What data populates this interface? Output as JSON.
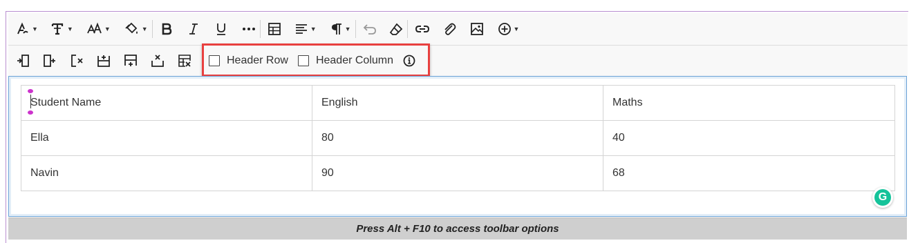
{
  "toolbar": {
    "row1": [
      {
        "name": "text-style-icon",
        "caret": true
      },
      {
        "name": "font-format-icon",
        "caret": true
      },
      {
        "name": "font-size-icon",
        "caret": true
      },
      {
        "name": "fill-color-icon",
        "caret": true
      },
      {
        "name": "bold-icon",
        "caret": false
      },
      {
        "name": "italic-icon",
        "caret": false
      },
      {
        "name": "underline-icon",
        "caret": false
      },
      {
        "name": "more-icon",
        "caret": false
      },
      {
        "name": "table-icon",
        "caret": false
      },
      {
        "name": "align-icon",
        "caret": true
      },
      {
        "name": "paragraph-icon",
        "caret": true
      },
      {
        "name": "undo-icon",
        "caret": false
      },
      {
        "name": "eraser-icon",
        "caret": false
      },
      {
        "name": "link-icon",
        "caret": false
      },
      {
        "name": "attach-icon",
        "caret": false
      },
      {
        "name": "image-icon",
        "caret": false
      },
      {
        "name": "add-content-icon",
        "caret": true
      }
    ],
    "row2": [
      "insert-column-before-icon",
      "insert-column-after-icon",
      "delete-column-icon",
      "insert-row-before-icon",
      "insert-row-after-icon",
      "delete-row-icon",
      "delete-table-icon"
    ],
    "header_row_label": "Header Row",
    "header_column_label": "Header Column",
    "header_row_checked": false,
    "header_column_checked": false
  },
  "table": {
    "rows": [
      [
        "Student Name",
        "English",
        "Maths"
      ],
      [
        "Ella",
        "80",
        "40"
      ],
      [
        "Navin",
        "90",
        "68"
      ]
    ]
  },
  "grammarly_letter": "G",
  "status_text": "Press Alt + F10 to access toolbar options",
  "colors": {
    "highlight": "#e8403f",
    "selection_handle": "#cc33cc",
    "grammarly": "#15c39a"
  }
}
